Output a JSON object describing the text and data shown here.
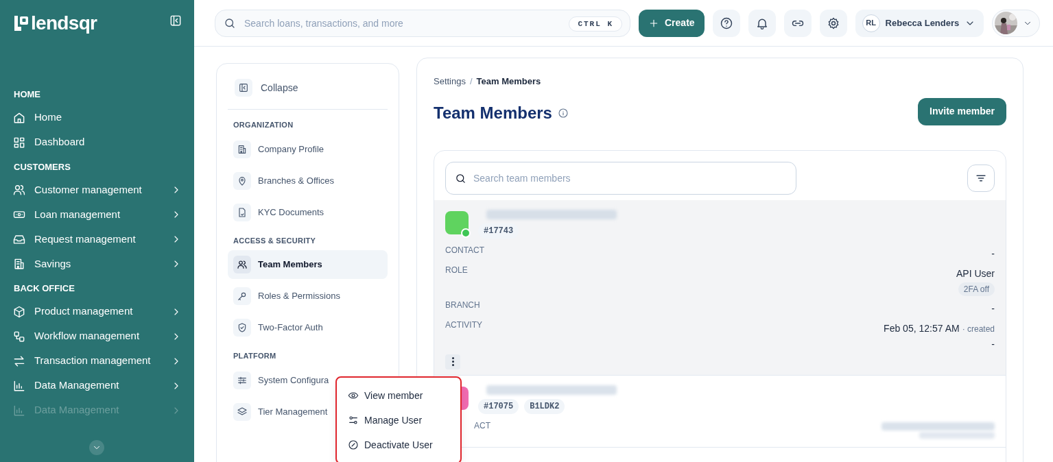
{
  "sidebar": {
    "logo": "lendsqr",
    "sections": [
      {
        "heading": "HOME",
        "items": [
          {
            "label": "Home",
            "has_submenu": false,
            "faded": false
          },
          {
            "label": "Dashboard",
            "has_submenu": false,
            "faded": false
          }
        ]
      },
      {
        "heading": "CUSTOMERS",
        "items": [
          {
            "label": "Customer management",
            "has_submenu": true,
            "faded": false
          },
          {
            "label": "Loan management",
            "has_submenu": true,
            "faded": false
          },
          {
            "label": "Request management",
            "has_submenu": true,
            "faded": false
          },
          {
            "label": "Savings",
            "has_submenu": true,
            "faded": false
          }
        ]
      },
      {
        "heading": "BACK OFFICE",
        "items": [
          {
            "label": "Product management",
            "has_submenu": true,
            "faded": false
          },
          {
            "label": "Workflow management",
            "has_submenu": true,
            "faded": false
          },
          {
            "label": "Transaction management",
            "has_submenu": true,
            "faded": false
          },
          {
            "label": "Data Management",
            "has_submenu": true,
            "faded": false
          },
          {
            "label": "Data Management",
            "has_submenu": true,
            "faded": true
          }
        ]
      }
    ]
  },
  "header": {
    "search": {
      "placeholder": "Search loans, transactions, and more",
      "shortcut": "CTRL K"
    },
    "create_button": "Create",
    "user": {
      "initials": "RL",
      "name": "Rebecca Lenders"
    }
  },
  "settings_nav": {
    "collapse": "Collapse",
    "groups": [
      {
        "heading": "ORGANIZATION",
        "items": [
          {
            "label": "Company Profile",
            "selected": false
          },
          {
            "label": "Branches & Offices",
            "selected": false
          },
          {
            "label": "KYC Documents",
            "selected": false
          }
        ]
      },
      {
        "heading": "ACCESS & SECURITY",
        "items": [
          {
            "label": "Team Members",
            "selected": true
          },
          {
            "label": "Roles & Permissions",
            "selected": false
          },
          {
            "label": "Two-Factor Auth",
            "selected": false
          }
        ]
      },
      {
        "heading": "PLATFORM",
        "items": [
          {
            "label": "System Configura",
            "selected": false
          },
          {
            "label": "Tier Management",
            "selected": false
          }
        ]
      }
    ]
  },
  "main": {
    "breadcrumb": [
      "Settings",
      "Team Members"
    ],
    "breadcrumb_separator": "/",
    "title": "Team Members",
    "invite_button": "Invite member",
    "search": {
      "placeholder": "Search team members"
    },
    "members": [
      {
        "color": "#5fd35f",
        "online": true,
        "highlighted": true,
        "tags": [
          "#17743"
        ],
        "fields": [
          {
            "label": "CONTACT",
            "value": "-"
          },
          {
            "label": "ROLE",
            "value": "API User",
            "badge": "2FA off"
          },
          {
            "label": "BRANCH",
            "value": "-"
          },
          {
            "label": "ACTIVITY",
            "value": "Feb 05, 12:57 AM",
            "note": "· created",
            "sub": "-"
          }
        ]
      },
      {
        "color": "#f06bb0",
        "online": false,
        "highlighted": false,
        "tags": [
          "#17075",
          "B1LDK2"
        ],
        "fields": [
          {
            "label": "ACT"
          }
        ]
      }
    ]
  },
  "row_menu": {
    "items": [
      "View member",
      "Manage User",
      "Deactivate User"
    ]
  }
}
